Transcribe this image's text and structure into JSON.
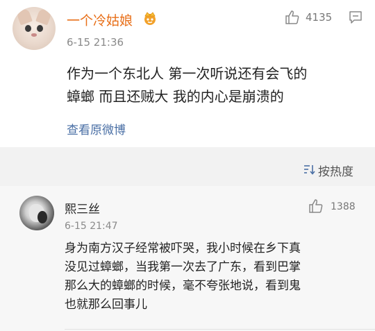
{
  "comment1": {
    "username": "一个冷姑娘",
    "badge_icon": "crown-vip-icon",
    "time": "6-15 21:36",
    "like_count": "4135",
    "like_icon": "thumbs-up-icon",
    "comment_icon": "comment-bubble-icon",
    "lines": [
      "作为一个东北人  第一次听说还有会飞的",
      "蟑螂 而且还贼大  我的内心是崩溃的"
    ],
    "view_original": "查看原微博"
  },
  "sort": {
    "icon": "sort-icon",
    "label": "按热度"
  },
  "comment2": {
    "username": "熙三丝",
    "time": "6-15 21:47",
    "like_count": "1388",
    "like_icon": "thumbs-up-icon",
    "lines": [
      "身为南方汉子经常被吓哭，我小时候在乡下真",
      "没见过蟑螂，当我第一次去了广东，看到巴掌",
      "那么大的蟑螂的时候，毫不夸张地说，看到鬼",
      "也就那么回事儿"
    ]
  },
  "colors": {
    "username_orange": "#e8701a",
    "link_blue": "#4a6fa5",
    "timestamp_gray": "#8a8a8a",
    "background": "#f2f2f2"
  }
}
